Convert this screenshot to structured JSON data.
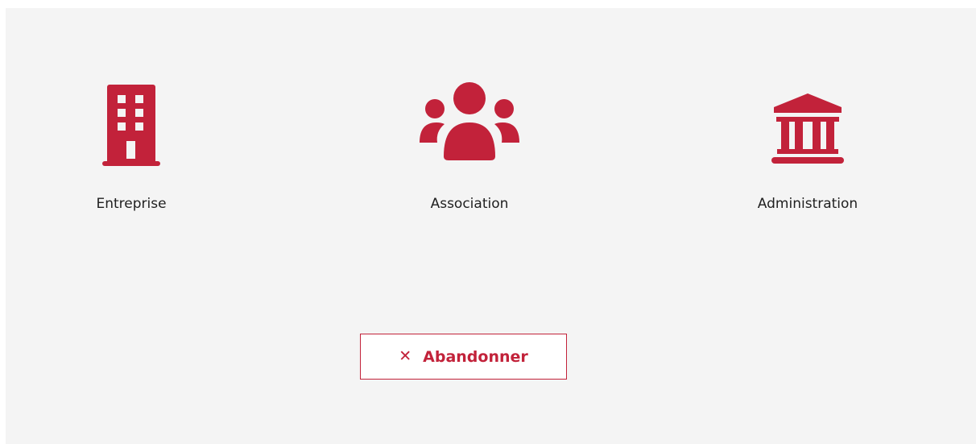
{
  "choices": [
    {
      "label": "Entreprise",
      "icon": "building-icon"
    },
    {
      "label": "Association",
      "icon": "users-icon"
    },
    {
      "label": "Administration",
      "icon": "government-building-icon"
    }
  ],
  "actions": {
    "abandon_label": "Abandonner",
    "abandon_icon": "close-icon",
    "abandon_glyph": "✕"
  },
  "colors": {
    "accent": "#c2223a",
    "panel_background": "#f4f4f4",
    "text": "#1f1f1f"
  }
}
